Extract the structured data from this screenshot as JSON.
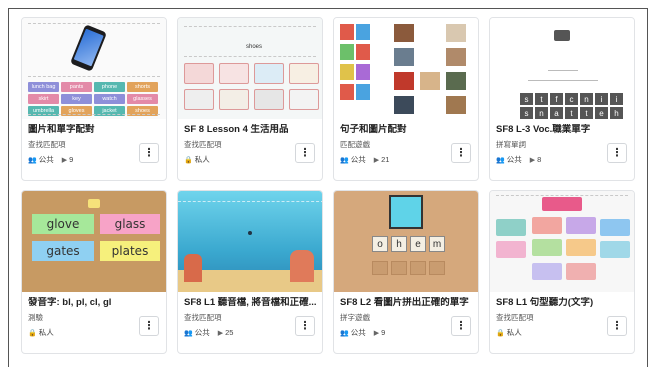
{
  "cards": [
    {
      "title": "圖片和單字配對",
      "type": "查找匹配項",
      "visibility": "公共",
      "plays": "9",
      "thumb_words": [
        "lunch bag",
        "pants",
        "phone",
        "shorts",
        "skirt",
        "key",
        "watch",
        "glasses",
        "umbrella",
        "gloves",
        "jacket",
        "shoes"
      ]
    },
    {
      "title": "SF 8 Lesson 4 生活用品",
      "type": "查找匹配項",
      "visibility": "私人",
      "plays": "",
      "thumb_word": "shoes"
    },
    {
      "title": "句子和圖片配對",
      "type": "匹配遊戲",
      "visibility": "公共",
      "plays": "21"
    },
    {
      "title": "SF8 L-3 Voc.職業單字",
      "type": "拼寫單詞",
      "visibility": "公共",
      "plays": "8",
      "thumb_letters": [
        "s",
        "t",
        "f",
        "c",
        "n",
        "i",
        "i",
        "s",
        "n",
        "a",
        "t",
        "t",
        "e",
        "h"
      ]
    },
    {
      "title": "發音字: bl, pl, cl, gl",
      "type": "測驗",
      "visibility": "私人",
      "plays": "",
      "thumb_words": [
        "glove",
        "glass",
        "gates",
        "plates"
      ]
    },
    {
      "title": "SF8 L1 聽音檔, 將音檔和正確...",
      "type": "查找匹配項",
      "visibility": "公共",
      "plays": "25"
    },
    {
      "title": "SF8 L2 看圖片拼出正確的單字",
      "type": "拼字遊戲",
      "visibility": "公共",
      "plays": "9",
      "thumb_letters": [
        "o",
        "h",
        "e",
        "m"
      ]
    },
    {
      "title": "SF8 L1 句型聽力(文字)",
      "type": "查找匹配項",
      "visibility": "私人",
      "plays": ""
    }
  ],
  "more_label": "⋮",
  "icons": {
    "public": "people-icon",
    "private": "lock-icon",
    "plays": "play-icon"
  },
  "colors": {
    "chip_purple": "#8e8fd9",
    "chip_pink": "#e38aa8",
    "chip_teal": "#56b8b0",
    "chip_orange": "#e2a35b",
    "sticky_green": "#a6e89a",
    "sticky_pink": "#f7a3c7",
    "sticky_blue": "#8fd0f2",
    "sticky_yellow": "#f6f07c"
  }
}
